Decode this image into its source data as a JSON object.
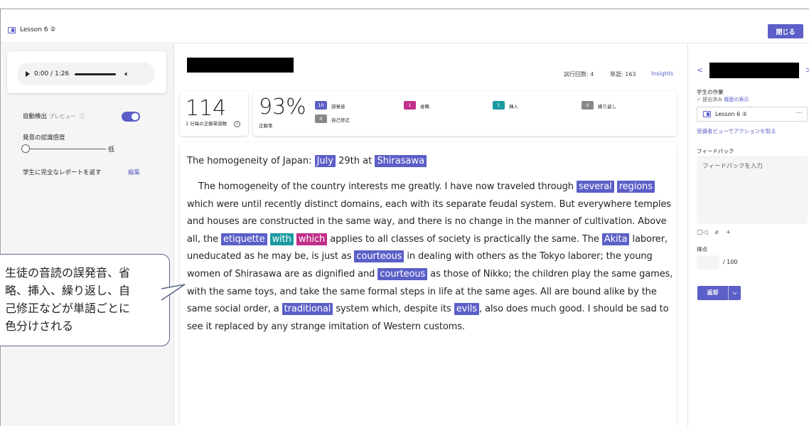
{
  "header": {
    "lesson_title": "Lesson 6 ②",
    "close_label": "閉じる"
  },
  "player": {
    "time": "0:00 / 1:26"
  },
  "settings": {
    "auto_detect_label": "自動検出",
    "preview_label": "プレビュー",
    "auto_detect_on": true,
    "sensitivity_label": "発音の認識感度",
    "sensitivity_value": "低",
    "full_report_label": "学生に完全なレポートを返す",
    "edit_label": "編集"
  },
  "stats": {
    "attempts": "試行回数: 4",
    "words": "単語: 163",
    "insights": "Insights",
    "wcpm_value": "114",
    "wcpm_label": "1 分毎の正解単語数",
    "accuracy_value": "93%",
    "accuracy_label": "正解率",
    "badges": [
      {
        "count": "10",
        "label": "誤発音",
        "color": "#5b5fc7"
      },
      {
        "count": "0",
        "label": "自己修正",
        "color": "#8a8886"
      },
      {
        "count": "1",
        "label": "省略",
        "color": "#c02f89"
      },
      {
        "count": "1",
        "label": "挿入",
        "color": "#1a9ba1"
      },
      {
        "count": "0",
        "label": "繰り返し",
        "color": "#8a8886"
      }
    ]
  },
  "passage": {
    "title_pre": "The homogeneity of Japan: ",
    "title_hl1": "July",
    "title_mid": " 29th at ",
    "title_hl2": "Shirasawa",
    "segments": [
      {
        "t": "The homogeneity of the country interests me greatly. I have now traveled through "
      },
      {
        "t": "several",
        "k": "mis"
      },
      {
        "t": " "
      },
      {
        "t": "regions",
        "k": "mis"
      },
      {
        "t": " which were until recently distinct domains, each with its separate feudal system. But everywhere temples and houses are constructed in the same way, and there is no change in the manner of cultivation. Above all, the "
      },
      {
        "t": "etiquette",
        "k": "mis"
      },
      {
        "t": " "
      },
      {
        "t": "with",
        "k": "ins"
      },
      {
        "t": " "
      },
      {
        "t": "which",
        "k": "omi"
      },
      {
        "t": " applies to all classes of society is practically the same. The "
      },
      {
        "t": "Akita",
        "k": "mis"
      },
      {
        "t": " laborer, uneducated as he may be, is just as "
      },
      {
        "t": "courteous",
        "k": "mis"
      },
      {
        "t": " in dealing with others as the Tokyo laborer; the young women of Shirasawa are as dignified and "
      },
      {
        "t": "courteous",
        "k": "mis"
      },
      {
        "t": " as those of Nikko; the children play the same games, with the same toys, and take the same formal steps in life at the same ages. All are bound alike by the same social order, a "
      },
      {
        "t": "traditional",
        "k": "mis"
      },
      {
        "t": " system which, despite its "
      },
      {
        "t": "evils",
        "k": "mis"
      },
      {
        "t": ", also does much good. I should be sad to see it replaced by any strange imitation of Western customs."
      }
    ]
  },
  "callout": {
    "text": "生徒の音読の誤発音、省略、挿入、繰り返し、自己修正などが単語ごとに色分けされる"
  },
  "right_panel": {
    "student_work_label": "学生の作業",
    "submitted_label": "✓ 提出済み",
    "history_link": "履歴の表示",
    "assignment_name": "Lesson 6 ②",
    "take_action_link": "受講者ビューでアクションを取る",
    "feedback_label": "フィードバック",
    "feedback_placeholder": "フィードバックを入力",
    "points_label": "得点",
    "points_total": "/ 100",
    "return_label": "返却"
  }
}
